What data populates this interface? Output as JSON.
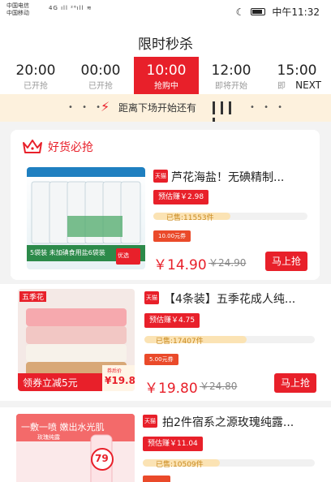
{
  "status_bar": {
    "carrier_1": "中国电信",
    "carrier_2": "中国移动",
    "signal": "4G ıll ²⁶ıll ≋",
    "time": "中午11:32"
  },
  "page_title": "限时秒杀",
  "time_tabs": [
    {
      "time": "20:00",
      "status": "已开抢",
      "active": false
    },
    {
      "time": "00:00",
      "status": "已开抢",
      "active": false
    },
    {
      "time": "10:00",
      "status": "抢购中",
      "active": true
    },
    {
      "time": "12:00",
      "status": "即将开始",
      "active": false
    },
    {
      "time": "15:00",
      "status": "即",
      "active": false
    }
  ],
  "next_label": "NEXT",
  "countdown": {
    "label": "距离下场开始还有"
  },
  "section": {
    "title": "好货必抢"
  },
  "products": [
    {
      "name": "芦花海盐！无碘精制...",
      "platform_badge": "天猫",
      "estimate": "预估赚￥2.98",
      "sold": "已售:11553件",
      "coupon": "10.00元券",
      "price": "￥14.90",
      "original_price": "￥24.90",
      "buy_label": "马上抢",
      "image_banner": "5袋装 未加碘食用盐6袋装",
      "image_tag": "优选",
      "sold_fraction": 0.5
    },
    {
      "name": "【4条装】五季花成人纯...",
      "platform_badge": "天猫",
      "estimate": "预估赚￥4.75",
      "sold": "已售:17407件",
      "coupon": "5.00元券",
      "price": "￥19.80",
      "original_price": "￥24.80",
      "buy_label": "马上抢",
      "image_brand": "五季花",
      "image_banner": "领券立减5元",
      "image_price": "¥19.8",
      "image_price_label": "券后价",
      "sold_fraction": 0.6
    },
    {
      "name": "拍2件宿系之源玫瑰纯露...",
      "platform_badge": "天猫",
      "estimate": "预估赚￥11.04",
      "sold": "已售:10509件",
      "image_banner": "一敷一喷 嫩出水光肌",
      "image_sub": "玫瑰纯露",
      "image_number": "79",
      "sold_fraction": 0.45
    }
  ],
  "colors": {
    "accent": "#e8202a",
    "countdown_bg": "#fdf1dd",
    "sold_text": "#c98a1f"
  }
}
